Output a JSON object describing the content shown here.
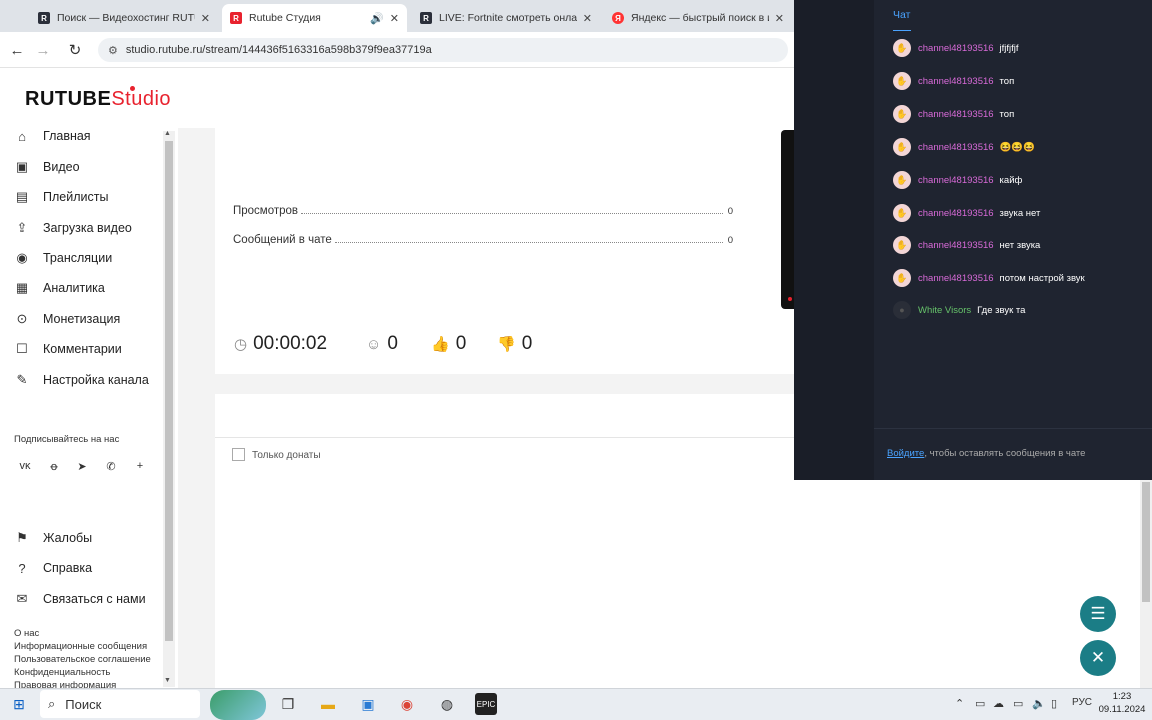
{
  "browser": {
    "tabs": [
      {
        "label": "Поиск — Видеохостинг RUTUBE",
        "icon": "rutube-favicon"
      },
      {
        "label": "Rutube Студия",
        "icon": "rutube-favicon",
        "active": true
      },
      {
        "label": "LIVE: Fortnite смотреть онлайн",
        "icon": "rutube-favicon"
      },
      {
        "label": "Яндекс — быстрый поиск в ин",
        "icon": "yandex-favicon"
      }
    ],
    "url": "studio.rutube.ru/stream/144436f5163316a598b379f9ea37719a"
  },
  "logo": {
    "brand": "RUTUBE",
    "suffix": "Studio"
  },
  "sidebar": {
    "nav": [
      {
        "label": "Главная",
        "icon": "home-icon"
      },
      {
        "label": "Видео",
        "icon": "video-icon"
      },
      {
        "label": "Плейлисты",
        "icon": "playlist-icon"
      },
      {
        "label": "Загрузка видео",
        "icon": "upload-icon"
      },
      {
        "label": "Трансляции",
        "icon": "broadcast-icon"
      },
      {
        "label": "Аналитика",
        "icon": "analytics-icon"
      },
      {
        "label": "Монетизация",
        "icon": "monetization-icon"
      },
      {
        "label": "Комментарии",
        "icon": "comments-icon"
      },
      {
        "label": "Настройка канала",
        "icon": "settings-icon"
      }
    ],
    "subscribe_label": "Подписывайтесь на нас",
    "social": [
      "vk-icon",
      "ok-icon",
      "telegram-icon",
      "viber-icon",
      "plus-icon"
    ],
    "help": [
      {
        "label": "Жалобы",
        "icon": "complaint-icon"
      },
      {
        "label": "Справка",
        "icon": "help-icon"
      },
      {
        "label": "Связаться с нами",
        "icon": "contact-icon"
      }
    ],
    "footer_links": [
      "О нас",
      "Информационные сообщения",
      "Пользовательское соглашение",
      "Конфиденциальность",
      "Правовая информация"
    ]
  },
  "stats": {
    "rows": [
      {
        "label": "Просмотров",
        "value": "0"
      },
      {
        "label": "Сообщений в чате",
        "value": "0"
      }
    ],
    "duration": "00:00:02",
    "viewers": "0",
    "likes": "0",
    "dislikes": "0"
  },
  "filter": {
    "donations_only": "Только донаты"
  },
  "chat": {
    "title": "Чат",
    "messages": [
      {
        "user": "channel48193516",
        "text": "jfjfjfjf"
      },
      {
        "user": "channel48193516",
        "text": "топ"
      },
      {
        "user": "channel48193516",
        "text": "топ"
      },
      {
        "user": "channel48193516",
        "text": "😆😆😆"
      },
      {
        "user": "channel48193516",
        "text": "кайф"
      },
      {
        "user": "channel48193516",
        "text": "звука нет"
      },
      {
        "user": "channel48193516",
        "text": "нет звука"
      },
      {
        "user": "channel48193516",
        "text": "потом настрой звук"
      },
      {
        "user": "White Visors",
        "text": "Где звук та"
      }
    ],
    "login_link": "Войдите",
    "login_rest": ", чтобы оставлять сообщения в чате"
  },
  "taskbar": {
    "search": "Поиск",
    "lang": "РУС",
    "time": "1:23",
    "date": "09.11.2024"
  }
}
